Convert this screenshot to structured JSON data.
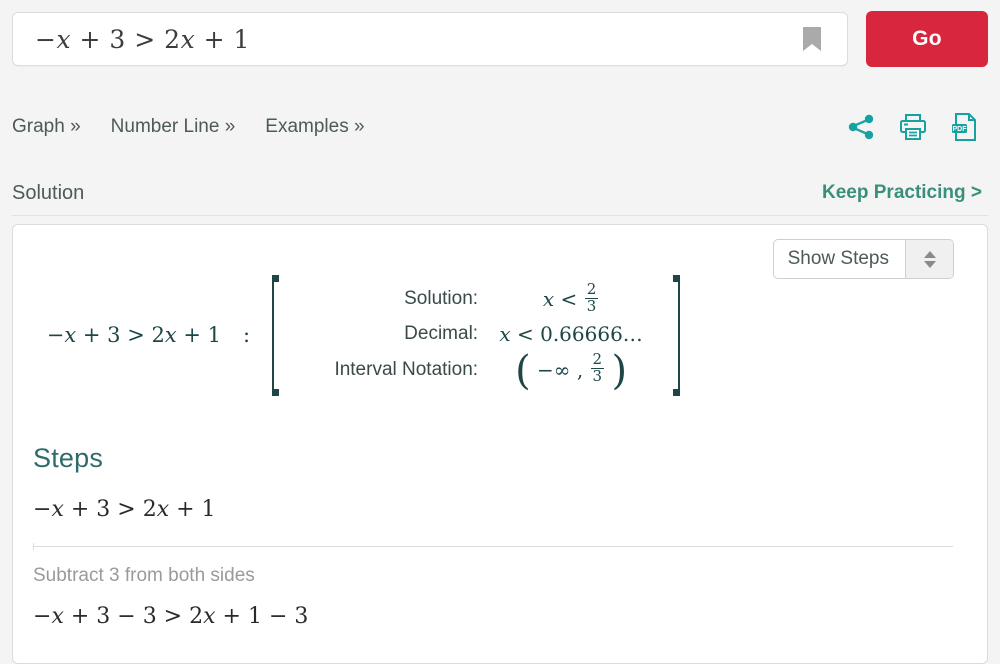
{
  "search": {
    "expression_plain": "-x + 3 > 2x + 1",
    "bookmark_icon": "bookmark-icon",
    "go_label": "Go",
    "go_color": "#d9263f"
  },
  "nav": {
    "links": [
      {
        "label": "Graph »",
        "name": "graph"
      },
      {
        "label": "Number Line »",
        "name": "number-line"
      },
      {
        "label": "Examples »",
        "name": "examples"
      }
    ],
    "icons": [
      {
        "name": "share-icon",
        "color": "#17a2a2"
      },
      {
        "name": "print-icon",
        "color": "#17a2a2"
      },
      {
        "name": "pdf-icon",
        "color": "#17a2a2",
        "label": "PDF"
      }
    ]
  },
  "solution_header": {
    "title": "Solution",
    "keep_practicing": "Keep Practicing >",
    "keep_practicing_color": "#3a8f7b"
  },
  "card": {
    "show_steps": {
      "label": "Show Steps",
      "stepper_up_icon": "chevron-up-icon",
      "stepper_down_icon": "chevron-down-icon"
    },
    "problem": {
      "lhs_plain": "-x + 3 > 2x + 1",
      "colon": ":"
    },
    "results": [
      {
        "label": "Solution:",
        "value_plain": "x < 2/3"
      },
      {
        "label": "Decimal:",
        "value_plain": "x < 0.66666…"
      },
      {
        "label": "Interval Notation:",
        "value_plain": "( -∞ , 2/3 )"
      }
    ],
    "steps": {
      "title": "Steps",
      "equation_1_plain": "-x + 3 > 2x + 1",
      "note_1": "Subtract 3 from both sides",
      "equation_2_plain": "-x + 3 - 3 > 2x + 1 - 3"
    }
  }
}
